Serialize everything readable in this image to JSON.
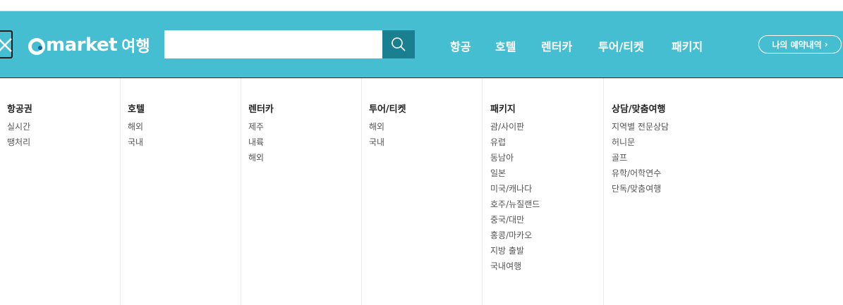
{
  "header": {
    "brand": "market",
    "brand_sub": "여행",
    "search_placeholder": "",
    "nav": [
      "항공",
      "호텔",
      "렌터카",
      "투어/티켓",
      "패키지"
    ],
    "reservation_label": "나의 예약내역",
    "reservation_arrow": "›"
  },
  "colors": {
    "header_bg": "#45bed2",
    "search_button": "#1b7f92"
  },
  "menu": [
    {
      "title": "항공권",
      "items": [
        "실시간",
        "땡처리"
      ]
    },
    {
      "title": "호텔",
      "items": [
        "해외",
        "국내"
      ]
    },
    {
      "title": "렌터카",
      "items": [
        "제주",
        "내륙",
        "해외"
      ]
    },
    {
      "title": "투어/티켓",
      "items": [
        "해외",
        "국내"
      ]
    },
    {
      "title": "패키지",
      "items": [
        "괌/사이판",
        "유럽",
        "동남아",
        "일본",
        "미국/캐나다",
        "호주/뉴질랜드",
        "중국/대만",
        "홍콩/마카오",
        "지방 출발",
        "국내여행"
      ]
    },
    {
      "title": "상담/맞춤여행",
      "items": [
        "지역별 전문상담",
        "허니문",
        "골프",
        "유학/어학연수",
        "단독/맞춤여행"
      ]
    }
  ]
}
